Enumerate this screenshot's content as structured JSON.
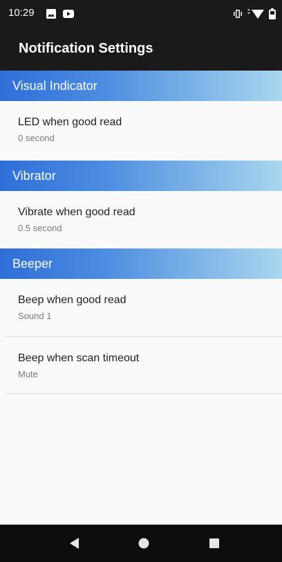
{
  "status_bar": {
    "time": "10:29",
    "icons": [
      "photo-icon",
      "video-icon",
      "vibrate-icon",
      "wifi-icon",
      "battery-icon"
    ]
  },
  "app_bar": {
    "title": "Notification Settings"
  },
  "sections": [
    {
      "header": "Visual Indicator",
      "items": [
        {
          "title": "LED when good read",
          "summary": "0 second"
        }
      ]
    },
    {
      "header": "Vibrator",
      "items": [
        {
          "title": "Vibrate when good read",
          "summary": "0.5 second"
        }
      ]
    },
    {
      "header": "Beeper",
      "items": [
        {
          "title": "Beep when good read",
          "summary": "Sound 1"
        },
        {
          "title": "Beep when scan timeout",
          "summary": "Mute"
        }
      ]
    }
  ],
  "nav_bar": {
    "buttons": [
      "back-icon",
      "home-icon",
      "recents-icon"
    ]
  },
  "colors": {
    "section_header_start": "#2f6fd8",
    "section_header_end": "#a9d7ef",
    "app_bar": "#1a1a1a",
    "background": "#fafafa"
  }
}
